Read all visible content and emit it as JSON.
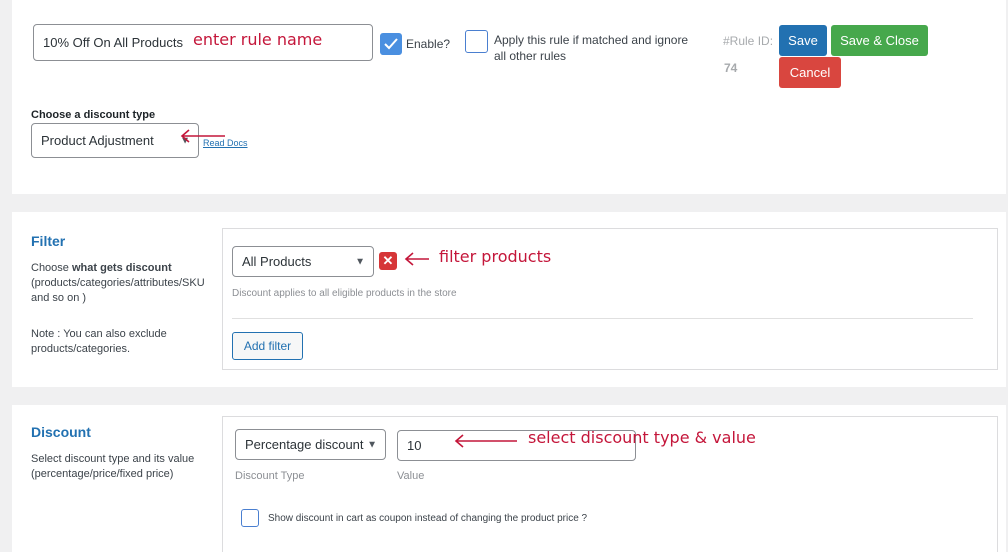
{
  "rule_header": {
    "rule_name_value": "10% Off On All Products",
    "rule_name_annotation": "enter rule name",
    "enable_label": "Enable?",
    "enable_checked": true,
    "exclusive_label_line1": "Apply this rule if matched and ignore",
    "exclusive_label_line2": "all other rules",
    "exclusive_checked": false,
    "rule_id_label": "#Rule ID:",
    "rule_id_value": "74",
    "save_label": "Save",
    "save_close_label": "Save & Close",
    "cancel_label": "Cancel"
  },
  "discount_type": {
    "heading": "Choose a discount type",
    "selected": "Product Adjustment",
    "read_docs": "Read Docs"
  },
  "filter_section": {
    "title": "Filter",
    "desc_prefix": "Choose ",
    "desc_bold": "what gets discount",
    "desc_line2": "(products/categories/attributes/SKU",
    "desc_line3": "and so on )",
    "note_line1": "Note : You can also exclude",
    "note_line2": "products/categories.",
    "filter_selected": "All Products",
    "remove_icon": "close-icon",
    "annotation": "filter products",
    "help_text": "Discount applies to all eligible products in the store",
    "add_filter_label": "Add filter"
  },
  "discount_section": {
    "title": "Discount",
    "desc_line1": "Select discount type and its value",
    "desc_line2": "(percentage/price/fixed price)",
    "type_selected": "Percentage discount",
    "type_caption": "Discount Type",
    "value": "10",
    "value_caption": "Value",
    "annotation": "select discount type & value",
    "coupon_label": "Show discount in cart as coupon instead of changing the product price ?",
    "coupon_checked": false
  },
  "colors": {
    "primary_blue": "#2271b1",
    "save_close_green": "#46a84c",
    "cancel_red": "#d9463f",
    "annotation_red": "#c4163a",
    "checkbox_blue": "#4a8fe0"
  }
}
